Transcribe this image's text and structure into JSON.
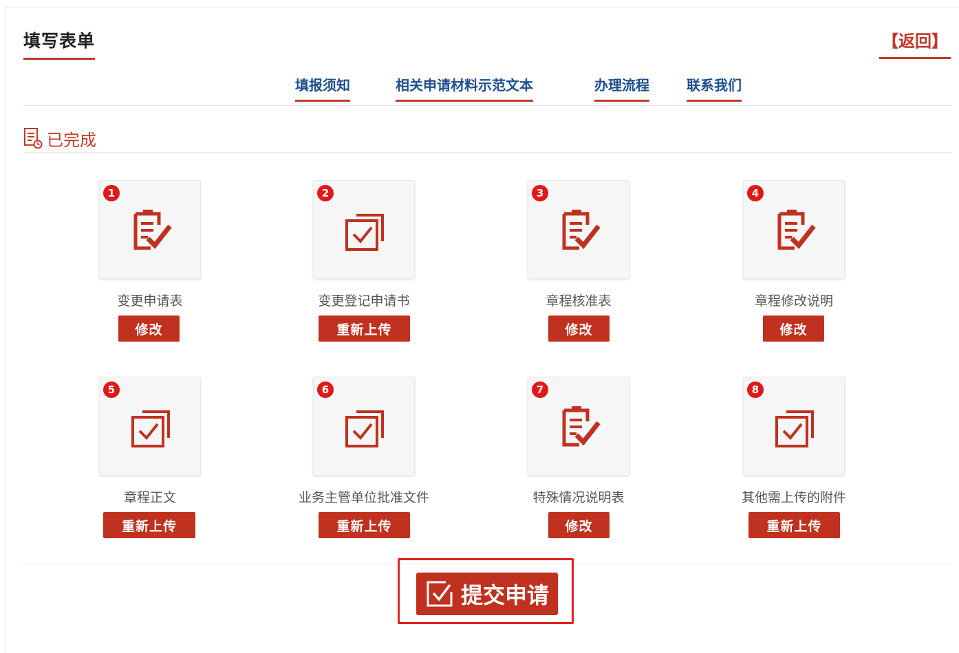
{
  "header": {
    "title": "填写表单",
    "back_label": "【返回】"
  },
  "tabs": [
    {
      "label": "填报须知"
    },
    {
      "label": "相关申请材料示范文本"
    },
    {
      "label": "办理流程"
    },
    {
      "label": "联系我们"
    }
  ],
  "status": {
    "label": "已完成"
  },
  "items": [
    {
      "number": "1",
      "icon": "form-check-icon",
      "label": "变更申请表",
      "button": "修改"
    },
    {
      "number": "2",
      "icon": "upload-check-icon",
      "label": "变更登记申请书",
      "button": "重新上传"
    },
    {
      "number": "3",
      "icon": "form-check-icon",
      "label": "章程核准表",
      "button": "修改"
    },
    {
      "number": "4",
      "icon": "form-check-icon",
      "label": "章程修改说明",
      "button": "修改"
    },
    {
      "number": "5",
      "icon": "upload-check-icon",
      "label": "章程正文",
      "button": "重新上传"
    },
    {
      "number": "6",
      "icon": "upload-check-icon",
      "label": "业务主管单位批准文件",
      "button": "重新上传"
    },
    {
      "number": "7",
      "icon": "form-check-icon",
      "label": "特殊情况说明表",
      "button": "修改"
    },
    {
      "number": "8",
      "icon": "upload-check-icon",
      "label": "其他需上传的附件",
      "button": "重新上传"
    }
  ],
  "submit": {
    "label": "提交申请"
  },
  "colors": {
    "accent": "#c0311f",
    "tab_text": "#1e4f8f",
    "badge": "#e01818"
  }
}
